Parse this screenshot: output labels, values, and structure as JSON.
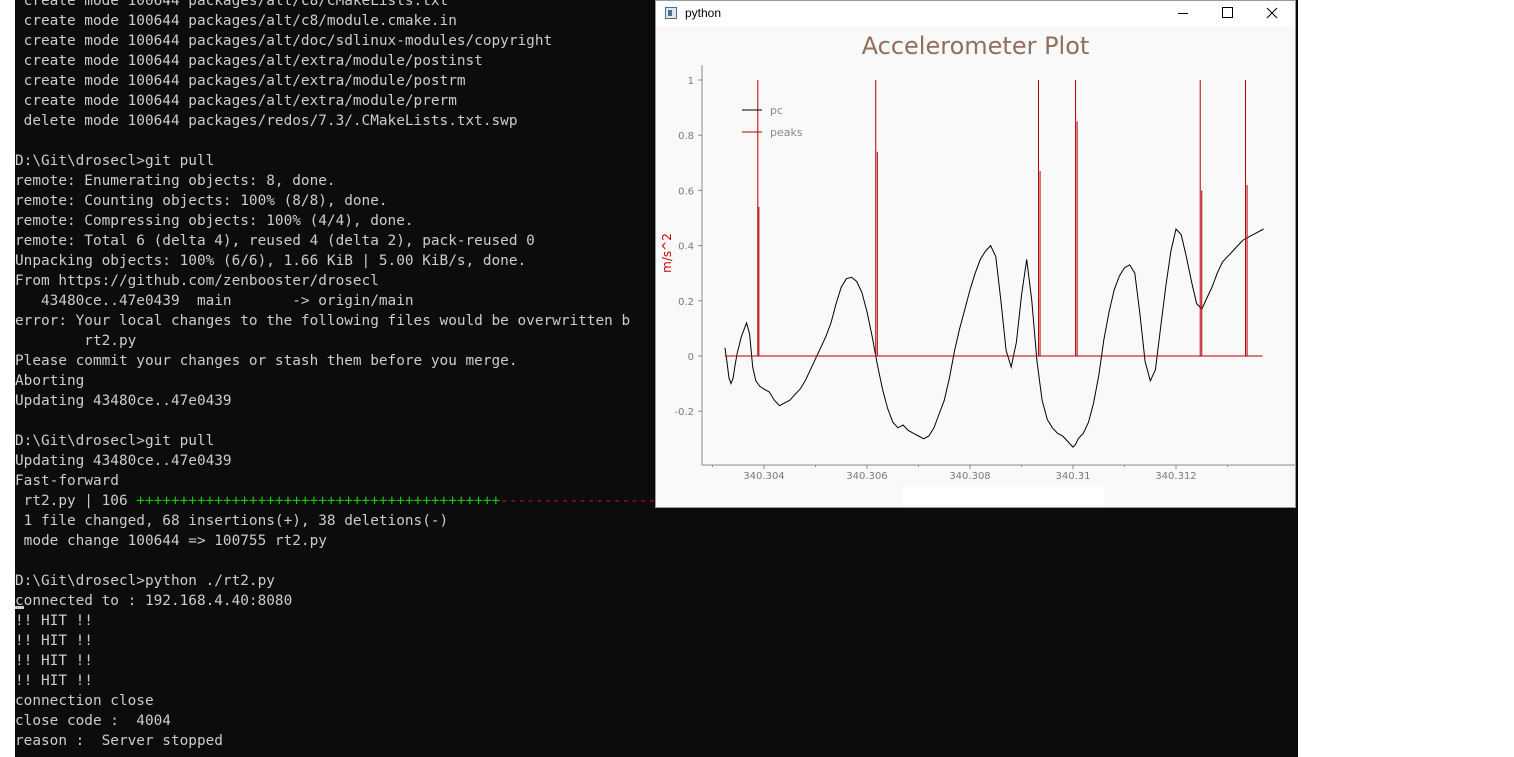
{
  "terminal": {
    "lines": [
      [
        {
          "t": " create mode 100644 packages/alt/c8/CMakeLists.txt"
        }
      ],
      [
        {
          "t": " create mode 100644 packages/alt/c8/module.cmake.in"
        }
      ],
      [
        {
          "t": " create mode 100644 packages/alt/doc/sdlinux-modules/copyright"
        }
      ],
      [
        {
          "t": " create mode 100644 packages/alt/extra/module/postinst"
        }
      ],
      [
        {
          "t": " create mode 100644 packages/alt/extra/module/postrm"
        }
      ],
      [
        {
          "t": " create mode 100644 packages/alt/extra/module/prerm"
        }
      ],
      [
        {
          "t": " delete mode 100644 packages/redos/7.3/.CMakeLists.txt.swp"
        }
      ],
      [
        {
          "t": ""
        }
      ],
      [
        {
          "t": "D:\\Git\\drosecl>git pull"
        }
      ],
      [
        {
          "t": "remote: Enumerating objects: 8, done."
        }
      ],
      [
        {
          "t": "remote: Counting objects: 100% (8/8), done."
        }
      ],
      [
        {
          "t": "remote: Compressing objects: 100% (4/4), done."
        }
      ],
      [
        {
          "t": "remote: Total 6 (delta 4), reused 4 (delta 2), pack-reused 0"
        }
      ],
      [
        {
          "t": "Unpacking objects: 100% (6/6), 1.66 KiB | 5.00 KiB/s, done."
        }
      ],
      [
        {
          "t": "From https://github.com/zenbooster/drosecl"
        }
      ],
      [
        {
          "t": "   43480ce..47e0439  main       -> origin/main"
        }
      ],
      [
        {
          "t": "error: Your local changes to the following files would be overwritten b"
        }
      ],
      [
        {
          "t": "        rt2.py"
        }
      ],
      [
        {
          "t": "Please commit your changes or stash them before you merge."
        }
      ],
      [
        {
          "t": "Aborting"
        }
      ],
      [
        {
          "t": "Updating 43480ce..47e0439"
        }
      ],
      [
        {
          "t": ""
        }
      ],
      [
        {
          "t": "D:\\Git\\drosecl>git pull"
        }
      ],
      [
        {
          "t": "Updating 43480ce..47e0439"
        }
      ],
      [
        {
          "t": "Fast-forward"
        }
      ],
      [
        {
          "t": " rt2.py | 106 "
        },
        {
          "t": "++++++++++++++++++++++++++++++++++++++++++",
          "c": "green"
        },
        {
          "t": "------------------------------------------",
          "c": "red"
        }
      ],
      [
        {
          "t": " 1 file changed, 68 insertions(+), 38 deletions(-)"
        }
      ],
      [
        {
          "t": " mode change 100644 => 100755 rt2.py"
        }
      ],
      [
        {
          "t": ""
        }
      ],
      [
        {
          "t": "D:\\Git\\drosecl>python ./rt2.py"
        }
      ],
      [
        {
          "t": "connected to : 192.168.4.40:8080"
        }
      ],
      [
        {
          "t": "!! HIT !!"
        }
      ],
      [
        {
          "t": "!! HIT !!"
        }
      ],
      [
        {
          "t": "!! HIT !!"
        }
      ],
      [
        {
          "t": "!! HIT !!"
        }
      ],
      [
        {
          "t": "connection close"
        }
      ],
      [
        {
          "t": "close code :  4004"
        }
      ],
      [
        {
          "t": "reason :  Server stopped"
        }
      ]
    ],
    "colors": {
      "green": "#16c60c",
      "red": "#c50f1f"
    }
  },
  "window": {
    "title": "python",
    "buttons": {
      "minimize": "─",
      "maximize": "☐",
      "close": "✕"
    }
  },
  "chart_data": {
    "type": "line",
    "title": "Accelerometer Plot",
    "xlabel": "",
    "ylabel": "m/s^2",
    "xlim": [
      340.30285,
      340.31385
    ],
    "ylim": [
      -0.24,
      1.05
    ],
    "xticks": [
      340.304,
      340.306,
      340.308,
      340.31,
      340.312
    ],
    "xtick_labels": [
      "340.304",
      "340.306",
      "340.308",
      "340.31",
      "340.312"
    ],
    "yticks": [
      -0.2,
      0,
      0.2,
      0.4,
      0.6,
      0.8,
      1
    ],
    "ytick_labels": [
      "-0.2",
      "0",
      "0.2",
      "0.4",
      "0.6",
      "0.8",
      "1"
    ],
    "legend": {
      "position": "top-left",
      "entries": [
        {
          "name": "pc",
          "color": "#000000"
        },
        {
          "name": "peaks",
          "color": "#b40000"
        }
      ]
    },
    "grid": false,
    "series": [
      {
        "name": "pc",
        "color": "#000000",
        "x": [
          340.30324,
          340.30328,
          340.30332,
          340.30336,
          340.3034,
          340.30344,
          340.30348,
          340.30352,
          340.30356,
          340.3036,
          340.30366,
          340.30372,
          340.30378,
          340.30384,
          340.30392,
          340.304,
          340.3041,
          340.3042,
          340.3043,
          340.3044,
          340.3045,
          340.3046,
          340.3047,
          340.3048,
          340.3049,
          340.305,
          340.3051,
          340.3052,
          340.3053,
          340.3054,
          340.3055,
          340.3056,
          340.3057,
          340.3058,
          340.3059,
          340.306,
          340.3061,
          340.3062,
          340.3063,
          340.3064,
          340.3065,
          340.3066,
          340.3067,
          340.3068,
          340.3069,
          340.307,
          340.3071,
          340.3072,
          340.3073,
          340.3074,
          340.3075,
          340.3076,
          340.3077,
          340.3078,
          340.3079,
          340.308,
          340.3081,
          340.3082,
          340.3083,
          340.3084,
          340.3085,
          340.3086,
          340.3087,
          340.3088,
          340.3089,
          340.309,
          340.3091,
          340.3092,
          340.3093,
          340.3094,
          340.3095,
          340.3096,
          340.3097,
          340.3098,
          340.3099,
          340.31,
          340.31005,
          340.3101,
          340.31015,
          340.3102,
          340.3103,
          340.3104,
          340.3105,
          340.3106,
          340.3107,
          340.3108,
          340.3109,
          340.311,
          340.3111,
          340.3112,
          340.3113,
          340.3114,
          340.3115,
          340.3116,
          340.3117,
          340.3118,
          340.3119,
          340.312,
          340.3121,
          340.3122,
          340.3123,
          340.3124,
          340.3125,
          340.3126,
          340.3127,
          340.3128,
          340.3129,
          340.313,
          340.3131,
          340.3132,
          340.3133,
          340.3134,
          340.3135,
          340.3136,
          340.3137
        ],
        "y": [
          0.03,
          -0.02,
          -0.08,
          -0.1,
          -0.08,
          -0.03,
          0.01,
          0.04,
          0.07,
          0.09,
          0.12,
          0.08,
          -0.04,
          -0.09,
          -0.11,
          -0.12,
          -0.13,
          -0.16,
          -0.18,
          -0.17,
          -0.16,
          -0.14,
          -0.12,
          -0.09,
          -0.05,
          -0.01,
          0.03,
          0.07,
          0.12,
          0.19,
          0.25,
          0.28,
          0.285,
          0.27,
          0.23,
          0.16,
          0.07,
          -0.03,
          -0.12,
          -0.19,
          -0.24,
          -0.26,
          -0.25,
          -0.27,
          -0.28,
          -0.29,
          -0.3,
          -0.29,
          -0.26,
          -0.21,
          -0.16,
          -0.08,
          0.02,
          0.1,
          0.17,
          0.24,
          0.3,
          0.35,
          0.38,
          0.4,
          0.36,
          0.2,
          0.02,
          -0.04,
          0.05,
          0.22,
          0.35,
          0.2,
          -0.02,
          -0.16,
          -0.23,
          -0.26,
          -0.28,
          -0.29,
          -0.31,
          -0.33,
          -0.32,
          -0.3,
          -0.29,
          -0.28,
          -0.24,
          -0.17,
          -0.07,
          0.06,
          0.16,
          0.24,
          0.29,
          0.32,
          0.33,
          0.3,
          0.15,
          -0.02,
          -0.09,
          -0.05,
          0.1,
          0.25,
          0.38,
          0.46,
          0.44,
          0.36,
          0.27,
          0.19,
          0.17,
          0.21,
          0.25,
          0.3,
          0.34,
          0.36,
          0.38,
          0.4,
          0.42,
          0.43,
          0.44,
          0.45,
          0.46
        ],
        "x_end": 340.31368
      },
      {
        "name": "peaks",
        "color": "#b40000",
        "baseline": 0,
        "x_start": 340.30324,
        "x_end": 340.31368,
        "peaks": [
          {
            "x": 340.30388,
            "y": 1.0
          },
          {
            "x": 340.3039,
            "y": 0.54
          },
          {
            "x": 340.30617,
            "y": 1.0
          },
          {
            "x": 340.3062,
            "y": 0.74
          },
          {
            "x": 340.30933,
            "y": 1.0
          },
          {
            "x": 340.30936,
            "y": 0.67
          },
          {
            "x": 340.31005,
            "y": 1.0
          },
          {
            "x": 340.31008,
            "y": 0.85
          },
          {
            "x": 340.31247,
            "y": 1.0
          },
          {
            "x": 340.3125,
            "y": 0.6
          },
          {
            "x": 340.31335,
            "y": 1.0
          },
          {
            "x": 340.31338,
            "y": 0.62
          }
        ]
      }
    ]
  }
}
